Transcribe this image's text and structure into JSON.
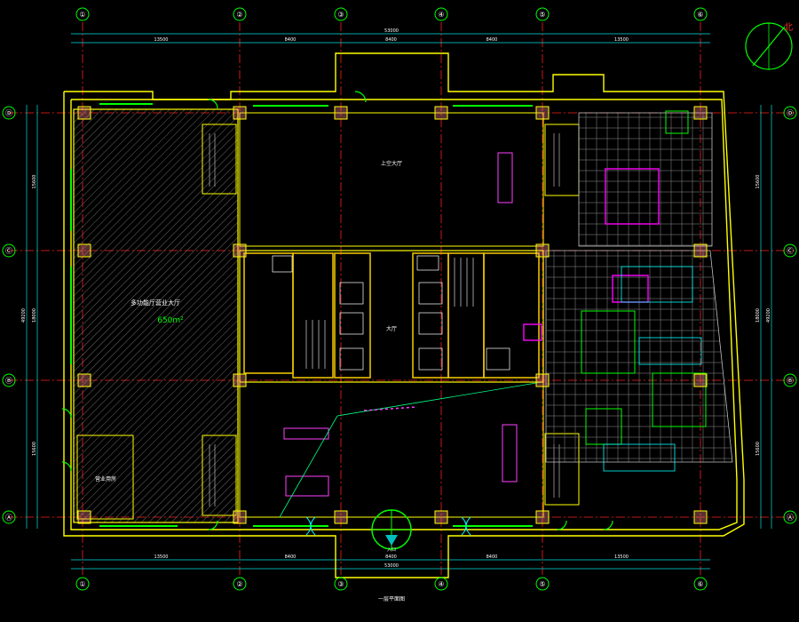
{
  "drawing": {
    "title": "一层平面图",
    "grid_columns": [
      "①",
      "②",
      "③",
      "④",
      "⑤",
      "⑥"
    ],
    "grid_rows": [
      "Ⓓ",
      "Ⓒ",
      "Ⓑ",
      "Ⓐ"
    ],
    "overall_dimension_top": "53000",
    "overall_dimension_bottom": "53000",
    "bay_dimensions_top": [
      "13500",
      "8400",
      "8400",
      "8400",
      "13500"
    ],
    "bay_dimensions_bottom": [
      "13500",
      "8400",
      "8400",
      "8400",
      "13500"
    ],
    "row_dimensions_left": [
      "15600",
      "18000",
      "15600"
    ],
    "row_dimensions_right": [
      "15600",
      "18000",
      "15600"
    ],
    "overall_dimension_side": "49200",
    "north_label": "北"
  },
  "rooms": {
    "big_hall": "多功能厅营业大厅",
    "big_hall_area": "650m²",
    "small_room": "营业用房",
    "top_atrium": "上空大厅",
    "central_hall": "大厅",
    "entrance_label": "入口"
  },
  "colors": {
    "wall": "#ffff00",
    "axis": "#ff2020",
    "dim": "#00e0e0",
    "door": "#00ff00",
    "hatch": "#808080",
    "furniture": "#ff00ff",
    "text": "#ffffff"
  }
}
